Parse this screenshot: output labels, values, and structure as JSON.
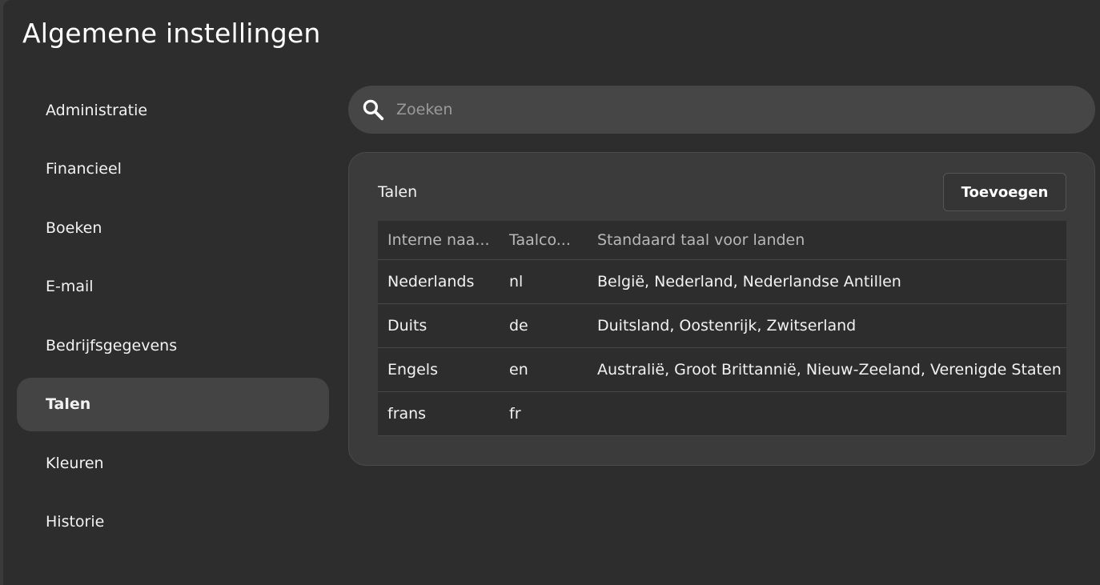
{
  "page": {
    "title": "Algemene instellingen"
  },
  "sidebar": {
    "items": [
      {
        "label": "Administratie"
      },
      {
        "label": "Financieel"
      },
      {
        "label": "Boeken"
      },
      {
        "label": "E-mail"
      },
      {
        "label": "Bedrijfsgegevens"
      },
      {
        "label": "Talen",
        "active": true
      },
      {
        "label": "Kleuren"
      },
      {
        "label": "Historie"
      }
    ]
  },
  "search": {
    "placeholder": "Zoeken",
    "value": "",
    "icon": "search-icon"
  },
  "card": {
    "title": "Talen",
    "add_button_label": "Toevoegen",
    "table": {
      "headers": [
        "Interne naa...",
        "Taalco...",
        "Standaard taal voor landen"
      ],
      "rows": [
        [
          "Nederlands",
          "nl",
          "België, Nederland, Nederlandse Antillen"
        ],
        [
          "Duits",
          "de",
          "Duitsland, Oostenrijk, Zwitserland"
        ],
        [
          "Engels",
          "en",
          "Australië, Groot Brittannië, Nieuw-Zeeland, Verenigde Staten"
        ],
        [
          "frans",
          "fr",
          ""
        ]
      ]
    }
  },
  "colors": {
    "background": "#2d2d2d",
    "sidebar_active": "#444444",
    "search_bg": "#464646",
    "card_bg": "#3b3b3b"
  }
}
